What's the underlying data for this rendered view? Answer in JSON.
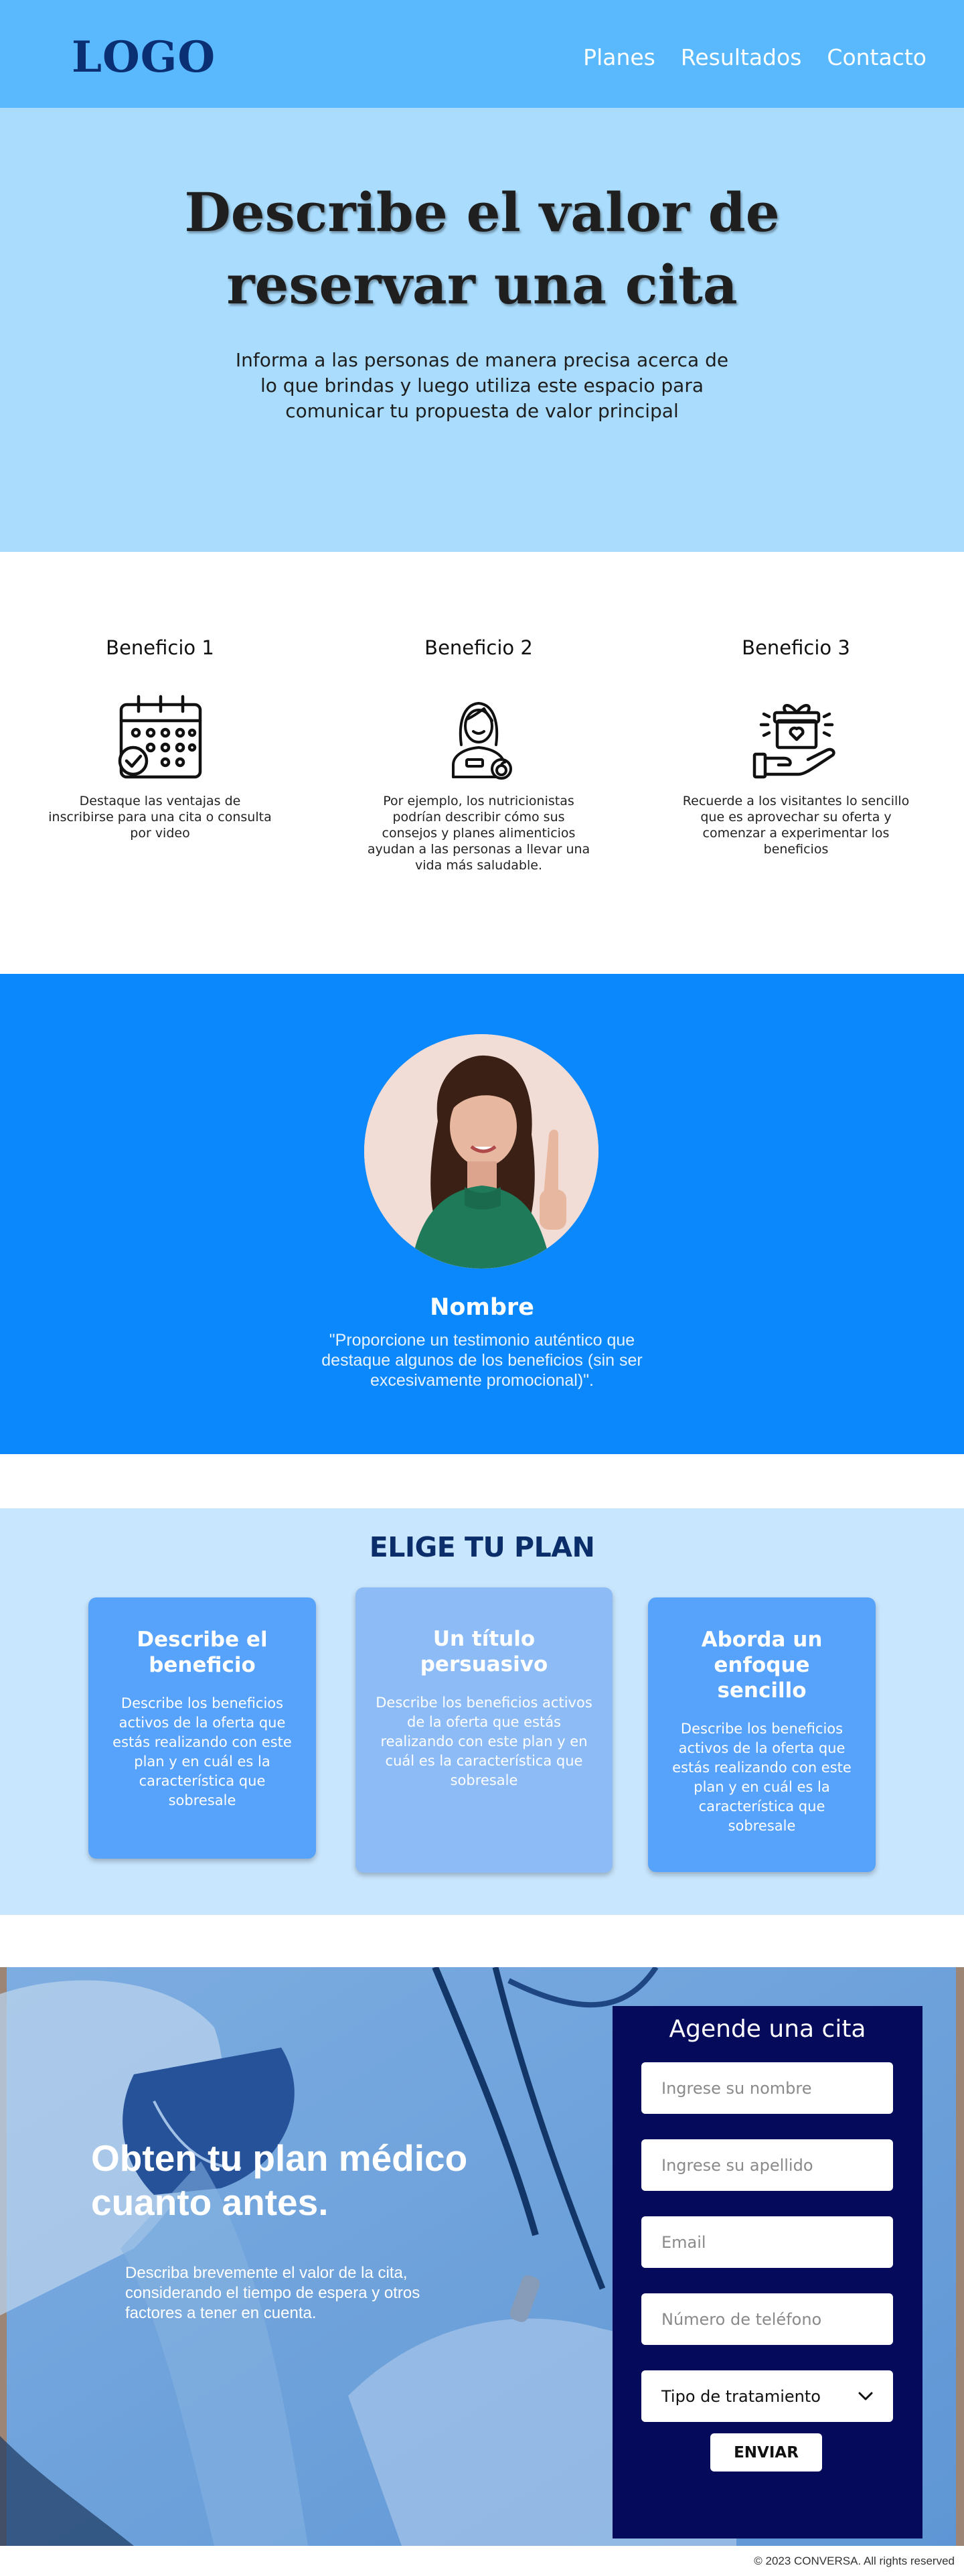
{
  "header": {
    "logo": "LOGO",
    "nav": [
      "Planes",
      "Resultados",
      "Contacto"
    ]
  },
  "hero": {
    "title_line1": "Describe el valor de",
    "title_line2": "reservar una cita",
    "subtitle": "Informa a las personas de manera precisa acerca de lo que brindas y luego utiliza este espacio para comunicar tu propuesta de valor principal"
  },
  "benefits": [
    {
      "title": "Beneficio 1",
      "icon": "calendar-check-icon",
      "text": "Destaque las ventajas de inscribirse para una cita o consulta por video"
    },
    {
      "title": "Beneficio 2",
      "icon": "nutritionist-icon",
      "text": "Por ejemplo, los nutricionistas podrían describir cómo sus consejos y planes alimenticios ayudan a las personas a llevar una vida más saludable."
    },
    {
      "title": "Beneficio 3",
      "icon": "gift-hand-icon",
      "text": "Recuerde a los visitantes lo sencillo que es aprovechar su oferta y comenzar a experimentar los beneficios"
    }
  ],
  "testimonial": {
    "name": "Nombre",
    "text": "\"Proporcione un testimonio auténtico que destaque algunos de los beneficios (sin ser excesivamente promocional)\"."
  },
  "plans": {
    "title": "ELIGE TU PLAN",
    "items": [
      {
        "title": "Describe el beneficio",
        "text": "Describe los beneficios activos de la oferta que estás realizando con este plan y en cuál es la característica que sobresale"
      },
      {
        "title": "Un título persuasivo",
        "text": "Describe los beneficios activos de la oferta que estás realizando con este plan y en cuál es la característica que sobresale"
      },
      {
        "title": "Aborda un enfoque sencillo",
        "text": "Describe los beneficios activos de la oferta que estás realizando con este plan y en cuál es la característica que sobresale"
      }
    ]
  },
  "cta": {
    "title": "Obten tu plan médico cuanto antes.",
    "text": "Describa brevemente el valor de la cita, considerando el tiempo de espera y otros factores a tener en cuenta."
  },
  "form": {
    "title": "Agende una cita",
    "placeholders": {
      "first_name": "Ingrese su nombre",
      "last_name": "Ingrese su apellido",
      "email": "Email",
      "phone": "Número de teléfono"
    },
    "select_label": "Tipo de tratamiento",
    "submit": "ENVIAR"
  },
  "footer": {
    "copyright": "© 2023 CONVERSA. All rights reserved"
  },
  "colors": {
    "header": "#5ab8fc",
    "hero": "#a9dcfd",
    "testimonial": "#0b88fb",
    "plans_bg": "#c8e6fe",
    "plan_card": "#57a2fb",
    "plan_card_featured": "#8cbbf6",
    "form_bg": "#050a5a",
    "brand_dark": "#0b2f73"
  }
}
